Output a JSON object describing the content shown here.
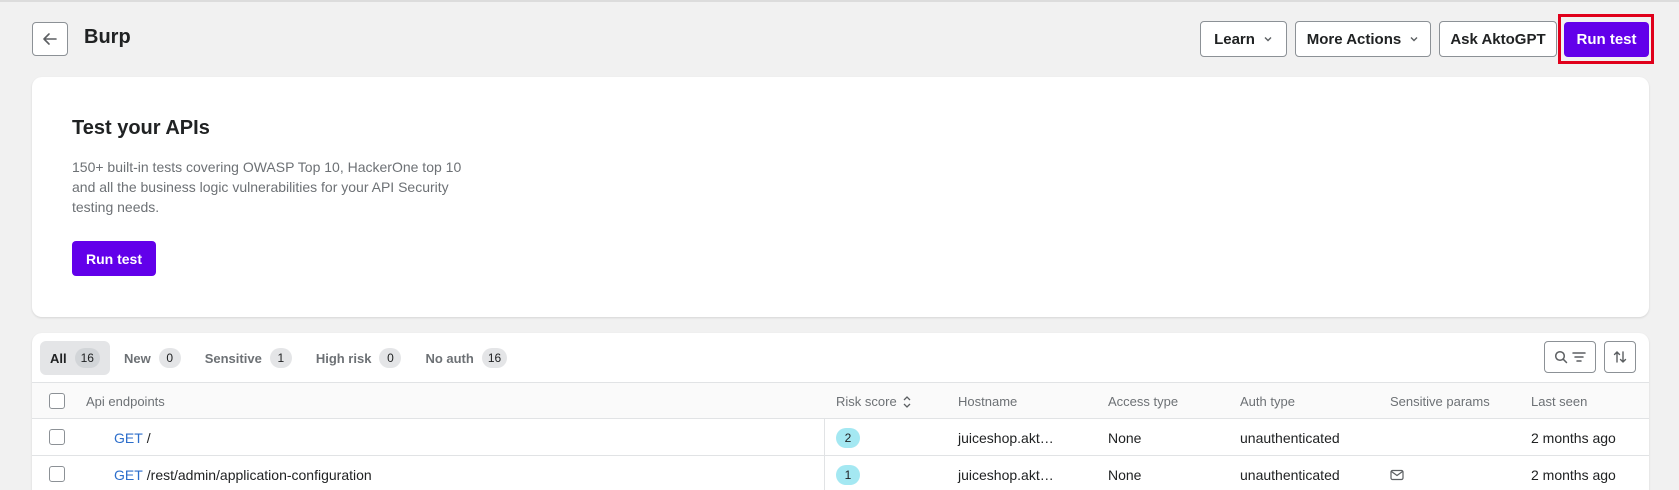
{
  "header": {
    "title": "Burp",
    "learn_label": "Learn",
    "more_actions_label": "More Actions",
    "ask_label": "Ask AktoGPT",
    "run_test_label": "Run test"
  },
  "banner": {
    "title": "Test your APIs",
    "description": "150+ built-in tests covering OWASP Top 10, HackerOne top 10 and all the business logic vulnerabilities for your API Security testing needs.",
    "button_label": "Run test"
  },
  "tabs": [
    {
      "label": "All",
      "count": "16"
    },
    {
      "label": "New",
      "count": "0"
    },
    {
      "label": "Sensitive",
      "count": "1"
    },
    {
      "label": "High risk",
      "count": "0"
    },
    {
      "label": "No auth",
      "count": "16"
    }
  ],
  "table": {
    "columns": [
      "Api endpoints",
      "Risk score",
      "Hostname",
      "Access type",
      "Auth type",
      "Sensitive params",
      "Last seen"
    ],
    "rows": [
      {
        "method": "GET",
        "path": "/",
        "risk": "2",
        "hostname": "juiceshop.akt…",
        "access": "None",
        "auth": "unauthenticated",
        "last_seen": "2 months ago"
      },
      {
        "method": "GET",
        "path": "/rest/admin/application-configuration",
        "risk": "1",
        "hostname": "juiceshop.akt…",
        "access": "None",
        "auth": "unauthenticated",
        "last_seen": "2 months ago"
      }
    ]
  },
  "colors": {
    "primary": "#6200ea",
    "highlight": "#e0001b",
    "risk_badge": "#a4e8f2",
    "method": "#2c6ecb"
  }
}
